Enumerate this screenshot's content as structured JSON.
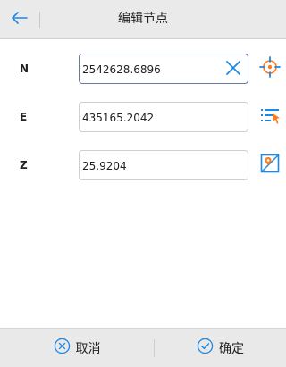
{
  "header": {
    "title": "编辑节点"
  },
  "fields": [
    {
      "label": "N",
      "value": "2542628.6896"
    },
    {
      "label": "E",
      "value": "435165.2042"
    },
    {
      "label": "Z",
      "value": "25.9204"
    }
  ],
  "footer": {
    "cancel_label": "取消",
    "confirm_label": "确定"
  },
  "icons": {
    "back": "arrow-left-icon",
    "clear": "close-icon",
    "gps": "gps-locate-icon",
    "list": "point-list-icon",
    "map": "map-pick-icon",
    "cancel": "circle-x-icon",
    "confirm": "circle-check-icon"
  },
  "colors": {
    "accent": "#1e88e5",
    "orange": "#ff7a1a"
  }
}
